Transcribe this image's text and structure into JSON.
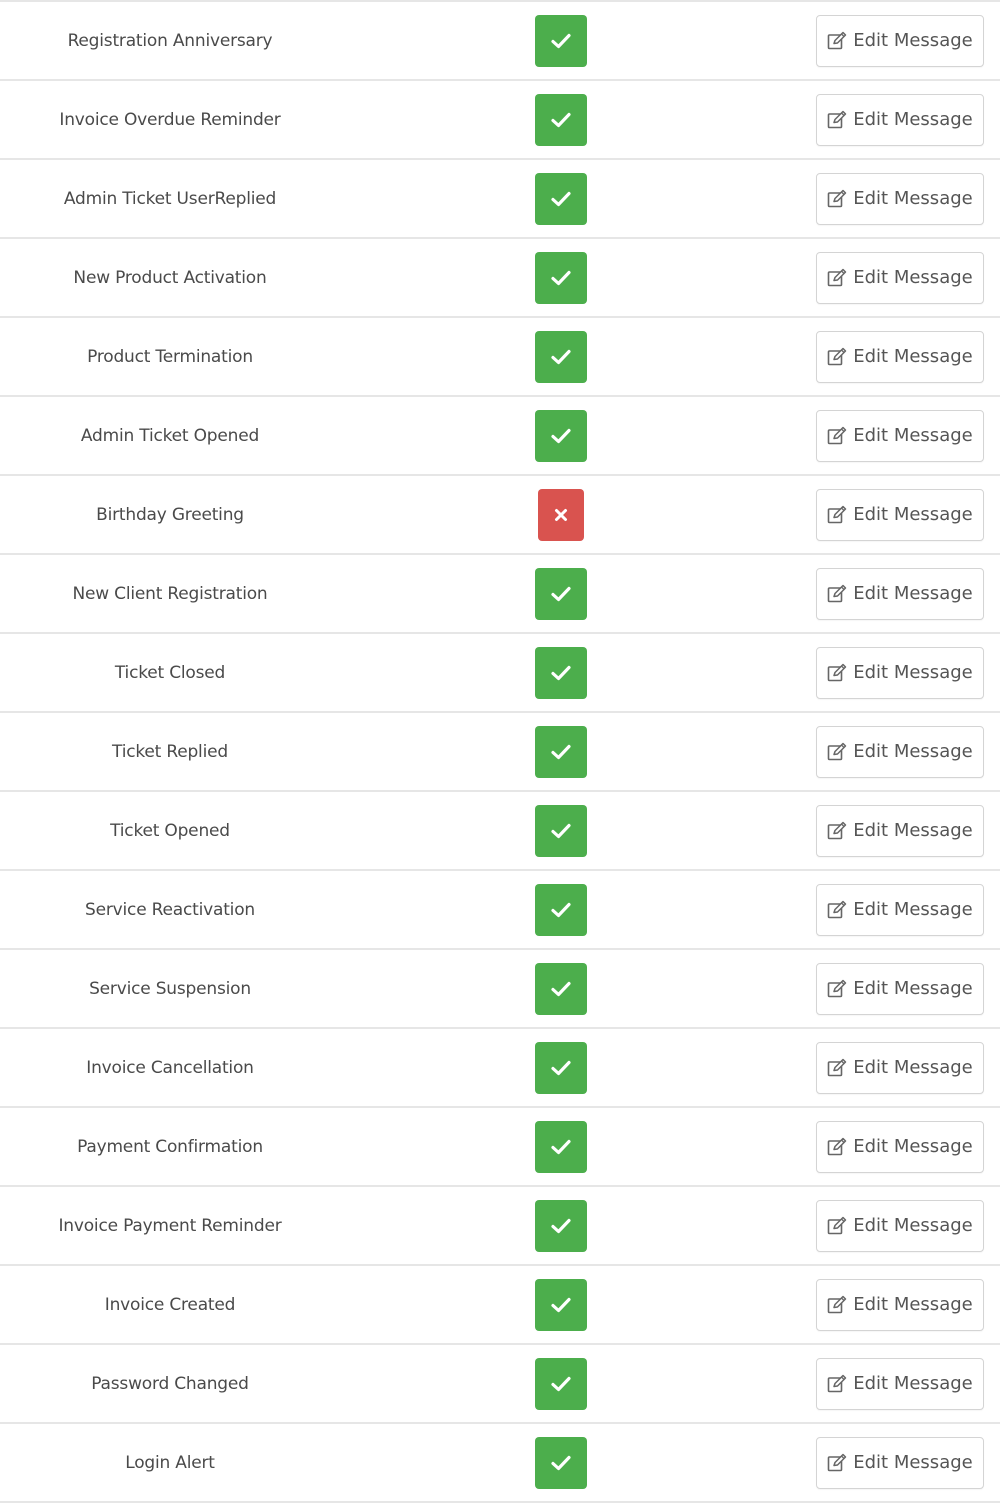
{
  "colors": {
    "enabled": "#4cae4c",
    "disabled": "#d9534f",
    "row_border": "#e6e6e6",
    "button_border": "#d4d4d4"
  },
  "icons": {
    "enabled": "check-icon",
    "disabled": "close-icon",
    "edit": "edit-icon"
  },
  "rows": [
    {
      "name": "Registration Anniversary",
      "enabled": true,
      "action": "Edit Message"
    },
    {
      "name": "Invoice Overdue Reminder",
      "enabled": true,
      "action": "Edit Message"
    },
    {
      "name": "Admin Ticket UserReplied",
      "enabled": true,
      "action": "Edit Message"
    },
    {
      "name": "New Product Activation",
      "enabled": true,
      "action": "Edit Message"
    },
    {
      "name": "Product Termination",
      "enabled": true,
      "action": "Edit Message"
    },
    {
      "name": "Admin Ticket Opened",
      "enabled": true,
      "action": "Edit Message"
    },
    {
      "name": "Birthday Greeting",
      "enabled": false,
      "action": "Edit Message"
    },
    {
      "name": "New Client Registration",
      "enabled": true,
      "action": "Edit Message"
    },
    {
      "name": "Ticket Closed",
      "enabled": true,
      "action": "Edit Message"
    },
    {
      "name": "Ticket Replied",
      "enabled": true,
      "action": "Edit Message"
    },
    {
      "name": "Ticket Opened",
      "enabled": true,
      "action": "Edit Message"
    },
    {
      "name": "Service Reactivation",
      "enabled": true,
      "action": "Edit Message"
    },
    {
      "name": "Service Suspension",
      "enabled": true,
      "action": "Edit Message"
    },
    {
      "name": "Invoice Cancellation",
      "enabled": true,
      "action": "Edit Message"
    },
    {
      "name": "Payment Confirmation",
      "enabled": true,
      "action": "Edit Message"
    },
    {
      "name": "Invoice Payment Reminder",
      "enabled": true,
      "action": "Edit Message"
    },
    {
      "name": "Invoice Created",
      "enabled": true,
      "action": "Edit Message"
    },
    {
      "name": "Password Changed",
      "enabled": true,
      "action": "Edit Message"
    },
    {
      "name": "Login Alert",
      "enabled": true,
      "action": "Edit Message"
    }
  ]
}
